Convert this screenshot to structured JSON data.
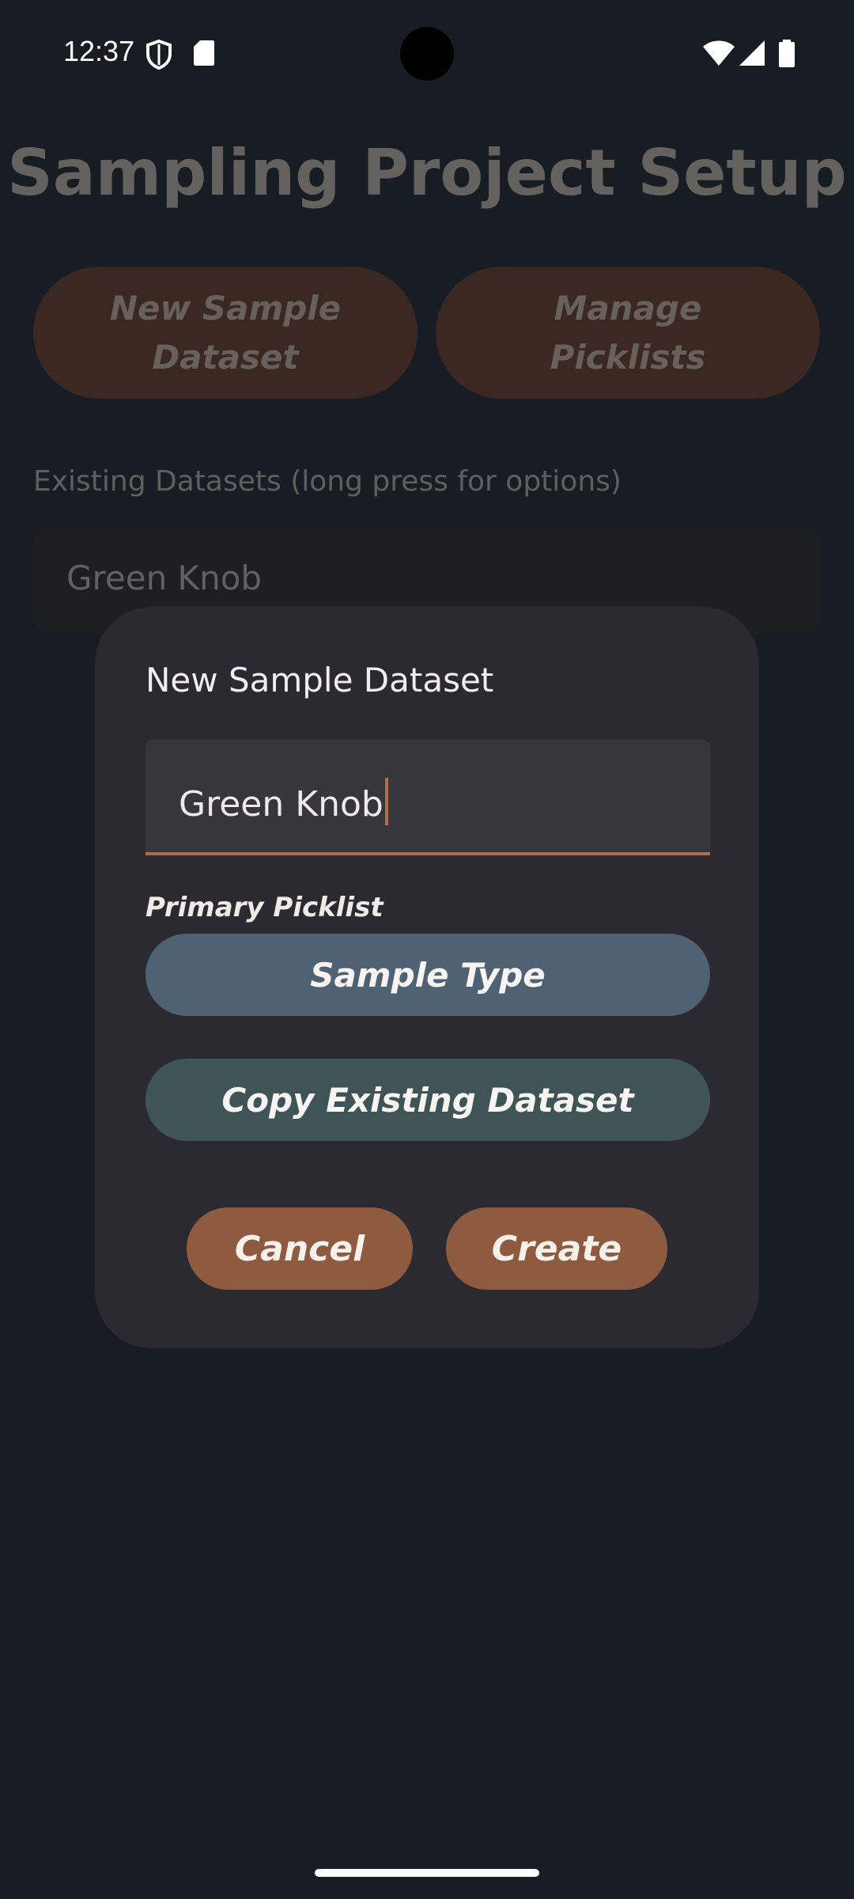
{
  "status_bar": {
    "time": "12:37",
    "icons": [
      "shield-icon",
      "sd-card-icon",
      "wifi-icon",
      "cell-signal-icon",
      "battery-icon"
    ]
  },
  "page": {
    "title": "Sampling Project Setup",
    "new_dataset_button": "New Sample\nDataset",
    "manage_picklists_button": "Manage\nPicklists",
    "existing_label": "Existing Datasets (long press for options)",
    "datasets": [
      "Green Knob"
    ]
  },
  "dialog": {
    "title": "New Sample Dataset",
    "name_value": "Green Knob",
    "primary_picklist_label": "Primary Picklist",
    "sample_type_button": "Sample Type",
    "copy_button": "Copy Existing Dataset",
    "cancel_button": "Cancel",
    "create_button": "Create"
  },
  "colors": {
    "background": "#171d23",
    "dialog": "#2b2a30",
    "accent": "#8e5b40",
    "sample_type": "#4f6273",
    "copy": "#3f5457"
  }
}
